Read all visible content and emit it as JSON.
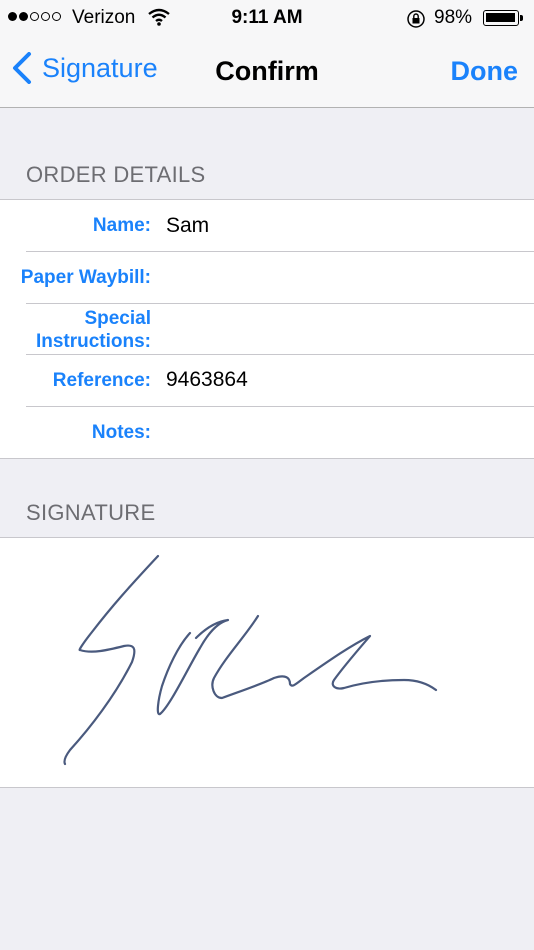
{
  "status_bar": {
    "carrier": "Verizon",
    "time": "9:11 AM",
    "battery_percent": "98%",
    "signal_bars_filled": 2,
    "signal_bars_total": 5
  },
  "nav": {
    "back_label": "Signature",
    "title": "Confirm",
    "done_label": "Done"
  },
  "order_details": {
    "header": "ORDER DETAILS",
    "rows": [
      {
        "label": "Name:",
        "value": "Sam"
      },
      {
        "label": "Paper Waybill:",
        "value": ""
      },
      {
        "label_line1": "Special",
        "label_line2": "Instructions:",
        "value": ""
      },
      {
        "label": "Reference:",
        "value": "9463864"
      },
      {
        "label": "Notes:",
        "value": ""
      }
    ]
  },
  "signature": {
    "header": "SIGNATURE",
    "stroke_color": "#4a5a7e"
  },
  "colors": {
    "accent": "#1a82fb",
    "background": "#efeff4",
    "section_header": "#6d6d72"
  }
}
